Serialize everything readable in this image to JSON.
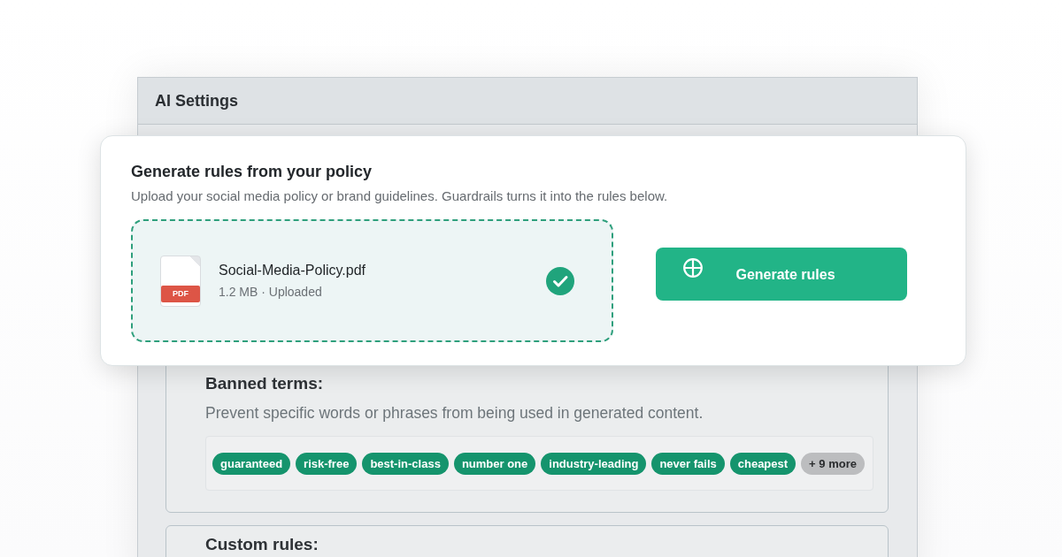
{
  "panel": {
    "title": "AI Settings"
  },
  "policy_card": {
    "title": "Generate rules from your policy",
    "subtitle": "Upload your social media policy or brand guidelines. Guardrails turns it into the rules below.",
    "file": {
      "type_label": "PDF",
      "name": "Social-Media-Policy.pdf",
      "meta": "1.2 MB · Uploaded",
      "uploaded": true
    },
    "button": "Generate rules"
  },
  "sections": [
    {
      "title": "Banned terms:",
      "description": "Prevent specific words or phrases from being used in generated content.",
      "tags": [
        {
          "label": "guaranteed",
          "kind": "term"
        },
        {
          "label": "risk-free",
          "kind": "term"
        },
        {
          "label": "best-in-class",
          "kind": "term"
        },
        {
          "label": "number one",
          "kind": "term"
        },
        {
          "label": "industry-leading",
          "kind": "term"
        },
        {
          "label": "never fails",
          "kind": "term"
        },
        {
          "label": "cheapest",
          "kind": "term"
        },
        {
          "label": "+ 9 more",
          "kind": "more"
        }
      ]
    },
    {
      "title": "Custom rules:"
    }
  ]
}
